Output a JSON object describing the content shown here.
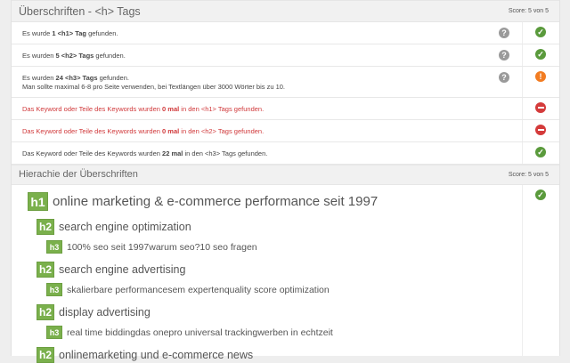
{
  "section1": {
    "title": "Überschriften - <h> Tags",
    "score": "Score: 5 von 5",
    "rows": [
      {
        "pre": "Es wurde ",
        "bold": "1 <h1> Tag",
        "post": " gefunden.",
        "status": "ok"
      },
      {
        "pre": "Es wurden ",
        "bold": "5 <h2> Tags",
        "post": " gefunden.",
        "status": "ok"
      },
      {
        "pre": "Es wurden ",
        "bold": "24 <h3> Tags",
        "post": " gefunden.",
        "line2": "Man sollte maximal 6-8 pro Seite verwenden, bei Textlängen über 3000 Wörter bis zu 10.",
        "status": "warning"
      },
      {
        "pre": "Das Keyword oder Teile des Keywords wurden ",
        "bold": "0 mal",
        "post": " in den <h1> Tags gefunden.",
        "status": "error"
      },
      {
        "pre": "Das Keyword oder Teile des Keywords wurden ",
        "bold": "0 mal",
        "post": " in den <h2> Tags gefunden.",
        "status": "error"
      },
      {
        "pre": "Das Keyword oder Teile des Keywords wurden ",
        "bold": "22 mal",
        "post": " in den <h3> Tags gefunden.",
        "status": "ok"
      }
    ]
  },
  "section2": {
    "title": "Hierachie der Überschriften",
    "score": "Score: 5 von 5",
    "status": "ok",
    "tree": [
      {
        "tag": "h1",
        "text": "online marketing & e-commerce performance seit 1997"
      },
      {
        "tag": "h2",
        "text": "search engine optimization"
      },
      {
        "tag": "h3",
        "text": "100% seo seit 1997warum seo?10 seo fragen"
      },
      {
        "tag": "h2",
        "text": "search engine advertising"
      },
      {
        "tag": "h3",
        "text": "skalierbare performancesem expertenquality score optimization"
      },
      {
        "tag": "h2",
        "text": "display advertising"
      },
      {
        "tag": "h3",
        "text": "real time biddingdas onepro universal trackingwerben in echtzeit"
      },
      {
        "tag": "h2",
        "text": "onlinemarketing und e-commerce news"
      }
    ]
  },
  "colors": {
    "ok": "#5a9a3c",
    "warning": "#f27c22",
    "error": "#d43b3b",
    "badge": "#7ab04c"
  }
}
